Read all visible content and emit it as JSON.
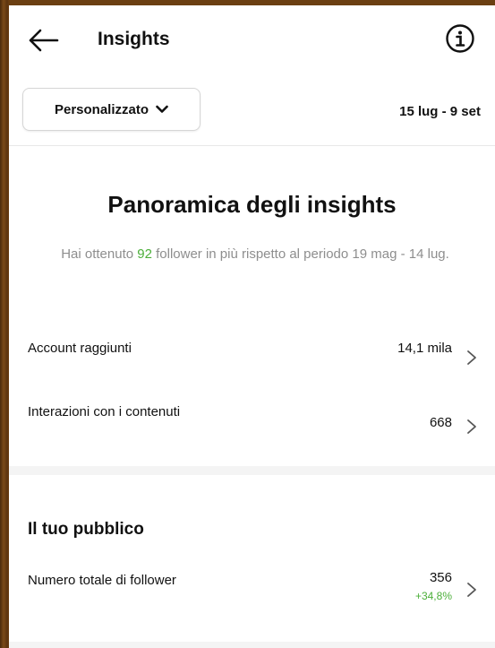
{
  "header": {
    "title": "Insights"
  },
  "filter": {
    "period_label": "Personalizzato",
    "date_range": "15 lug - 9 set"
  },
  "overview": {
    "title": "Panoramica degli insights",
    "summary_prefix": "Hai ottenuto ",
    "follower_gain": "92",
    "summary_suffix": " follower in più rispetto al periodo 19 mag - 14 lug."
  },
  "metrics": [
    {
      "label": "Account raggiunti",
      "value": "14,1 mila"
    },
    {
      "label": "Interazioni con i contenuti",
      "value": "668"
    }
  ],
  "audience": {
    "title": "Il tuo pubblico",
    "followers_label": "Numero totale di follower",
    "followers_value": "356",
    "followers_change": "+34,8%"
  },
  "colors": {
    "positive": "#4caf3a",
    "muted_text": "#8e8e8e"
  }
}
